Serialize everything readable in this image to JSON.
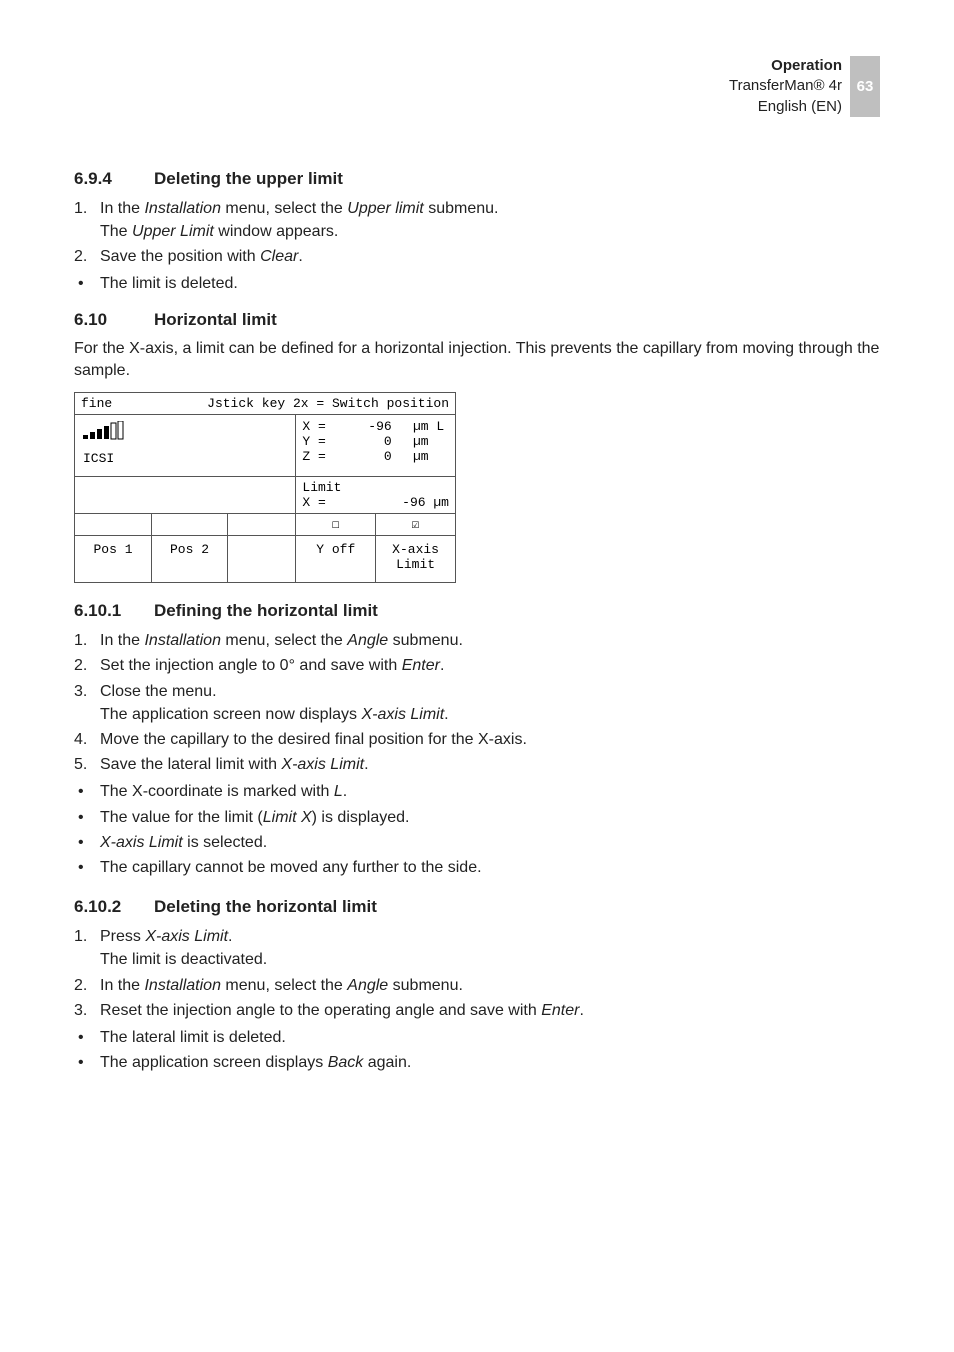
{
  "header": {
    "title": "Operation",
    "product": "TransferMan® 4r",
    "lang": "English (EN)",
    "page": "63"
  },
  "s694": {
    "num": "6.9.4",
    "title": "Deleting the upper limit",
    "step1_a": "In the ",
    "step1_b": "Installation",
    "step1_c": " menu, select the ",
    "step1_d": "Upper limit",
    "step1_e": " submenu.",
    "step1_line2_a": "The ",
    "step1_line2_b": "Upper Limit",
    "step1_line2_c": " window appears.",
    "step2_a": "Save the position with ",
    "step2_b": "Clear",
    "step2_c": ".",
    "bul1": "The limit is deleted."
  },
  "s610": {
    "num": "6.10",
    "title": "Horizontal limit",
    "para": "For the X-axis, a limit can be defined for a horizontal injection. This prevents the capillary from moving through the sample."
  },
  "device": {
    "top_left": "fine",
    "top_right": "Jstick key 2x = Switch position",
    "mode": "ICSI",
    "x_lab": "X =",
    "x_val": "-96",
    "x_unit": "µm L",
    "y_lab": "Y =",
    "y_val": "0",
    "y_unit": "µm",
    "z_lab": "Z =",
    "z_val": "0",
    "z_unit": "µm",
    "lim_lab1": "Limit",
    "lim_lab2": "X =",
    "lim_val": "-96",
    "lim_unit": "µm",
    "chk_off": "☐",
    "chk_on": "☑",
    "btn1": "Pos 1",
    "btn2": "Pos 2",
    "btn3": "",
    "btn4": "Y off",
    "btn5a": "X-axis",
    "btn5b": "Limit"
  },
  "s6101": {
    "num": "6.10.1",
    "title": "Defining the horizontal limit",
    "st1_a": "In the ",
    "st1_b": "Installation",
    "st1_c": " menu, select the ",
    "st1_d": "Angle",
    "st1_e": " submenu.",
    "st2_a": "Set the injection angle to 0° and save with ",
    "st2_b": "Enter",
    "st2_c": ".",
    "st3": "Close the menu.",
    "st3_line2_a": "The application screen now displays ",
    "st3_line2_b": "X-axis Limit",
    "st3_line2_c": ".",
    "st4": "Move the capillary to the desired final position for the X-axis.",
    "st5_a": "Save the lateral limit with ",
    "st5_b": "X-axis Limit",
    "st5_c": ".",
    "b1_a": "The X-coordinate is marked with ",
    "b1_b": "L",
    "b1_c": ".",
    "b2_a": "The value for the limit (",
    "b2_b": "Limit X",
    "b2_c": ") is displayed.",
    "b3_a": "X-axis Limit",
    "b3_b": " is selected.",
    "b4": "The capillary cannot be moved any further to the side."
  },
  "s6102": {
    "num": "6.10.2",
    "title": "Deleting the horizontal limit",
    "st1_a": "Press ",
    "st1_b": "X-axis Limit",
    "st1_c": ".",
    "st1_line2": "The limit is deactivated.",
    "st2_a": "In the ",
    "st2_b": "Installation",
    "st2_c": " menu, select the ",
    "st2_d": "Angle",
    "st2_e": " submenu.",
    "st3_a": "Reset the injection angle to the operating angle and save with ",
    "st3_b": "Enter",
    "st3_c": ".",
    "b1": "The lateral limit is deleted.",
    "b2_a": "The application screen displays ",
    "b2_b": "Back",
    "b2_c": " again."
  }
}
